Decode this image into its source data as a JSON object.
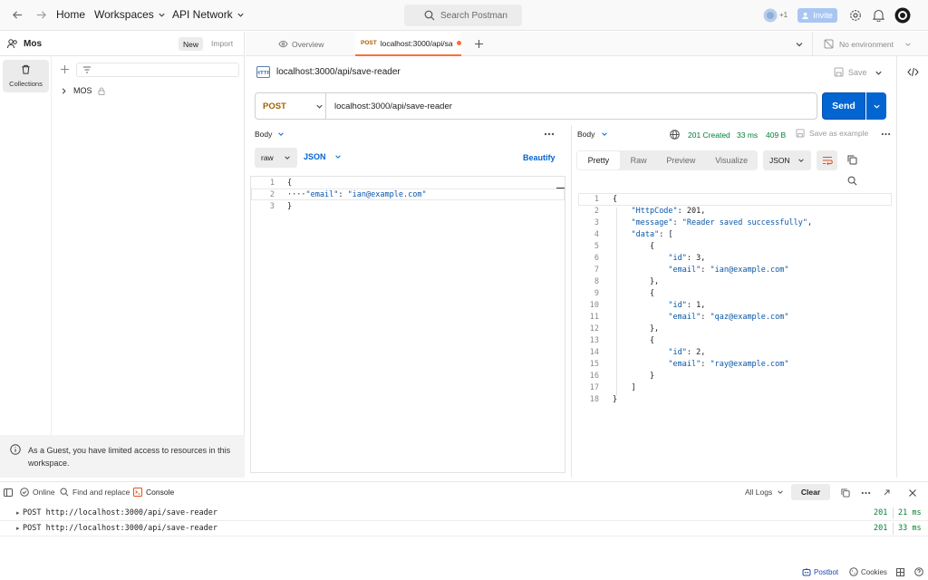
{
  "topbar": {
    "home": "Home",
    "workspaces": "Workspaces",
    "api_network": "API Network",
    "search_placeholder": "Search Postman",
    "plus_count": "+1",
    "invite": "Invite"
  },
  "sidebar": {
    "workspace_name": "Mos",
    "new_label": "New",
    "import_label": "Import",
    "collections_label": "Collections",
    "collection_item": "MOS",
    "guest_notice": "As a Guest, you have limited access to resources in this workspace."
  },
  "tabs": {
    "overview": "Overview",
    "active_method": "POST",
    "active_title": "localhost:3000/api/sav",
    "environment": "No environment"
  },
  "request": {
    "title": "localhost:3000/api/save-reader",
    "save_label": "Save",
    "method": "POST",
    "url": "localhost:3000/api/save-reader",
    "send_label": "Send",
    "body_label": "Body",
    "raw_label": "raw",
    "json_label": "JSON",
    "beautify_label": "Beautify",
    "code_lines": [
      {
        "num": "1",
        "text": "{"
      },
      {
        "num": "2",
        "text": "····\"email\": \"ian@example.com\""
      },
      {
        "num": "3",
        "text": "}"
      }
    ]
  },
  "response": {
    "body_label": "Body",
    "status": "201 Created",
    "time": "33 ms",
    "size": "409 B",
    "save_example": "Save as example",
    "tabs": [
      "Pretty",
      "Raw",
      "Preview",
      "Visualize"
    ],
    "format": "JSON",
    "code_lines": [
      {
        "num": "1",
        "text": "{"
      },
      {
        "num": "2",
        "text": "    \"HttpCode\": 201,"
      },
      {
        "num": "3",
        "text": "    \"message\": \"Reader saved successfully\","
      },
      {
        "num": "4",
        "text": "    \"data\": ["
      },
      {
        "num": "5",
        "text": "        {"
      },
      {
        "num": "6",
        "text": "            \"id\": 3,"
      },
      {
        "num": "7",
        "text": "            \"email\": \"ian@example.com\""
      },
      {
        "num": "8",
        "text": "        },"
      },
      {
        "num": "9",
        "text": "        {"
      },
      {
        "num": "10",
        "text": "            \"id\": 1,"
      },
      {
        "num": "11",
        "text": "            \"email\": \"qaz@example.com\""
      },
      {
        "num": "12",
        "text": "        },"
      },
      {
        "num": "13",
        "text": "        {"
      },
      {
        "num": "14",
        "text": "            \"id\": 2,"
      },
      {
        "num": "15",
        "text": "            \"email\": \"ray@example.com\""
      },
      {
        "num": "16",
        "text": "        }"
      },
      {
        "num": "17",
        "text": "    ]"
      },
      {
        "num": "18",
        "text": "}"
      }
    ]
  },
  "console": {
    "online": "Online",
    "find_replace": "Find and replace",
    "console_label": "Console",
    "all_logs": "All Logs",
    "clear": "Clear",
    "logs": [
      {
        "text": "POST http://localhost:3000/api/save-reader",
        "status": "201",
        "time": "21 ms"
      },
      {
        "text": "POST http://localhost:3000/api/save-reader",
        "status": "201",
        "time": "33 ms"
      }
    ]
  },
  "footer": {
    "postbot": "Postbot",
    "cookies": "Cookies"
  },
  "colors": {
    "accent": "#0265d2",
    "post": "#a66000",
    "success": "#007f31",
    "active_tab": "#ff6c37"
  }
}
